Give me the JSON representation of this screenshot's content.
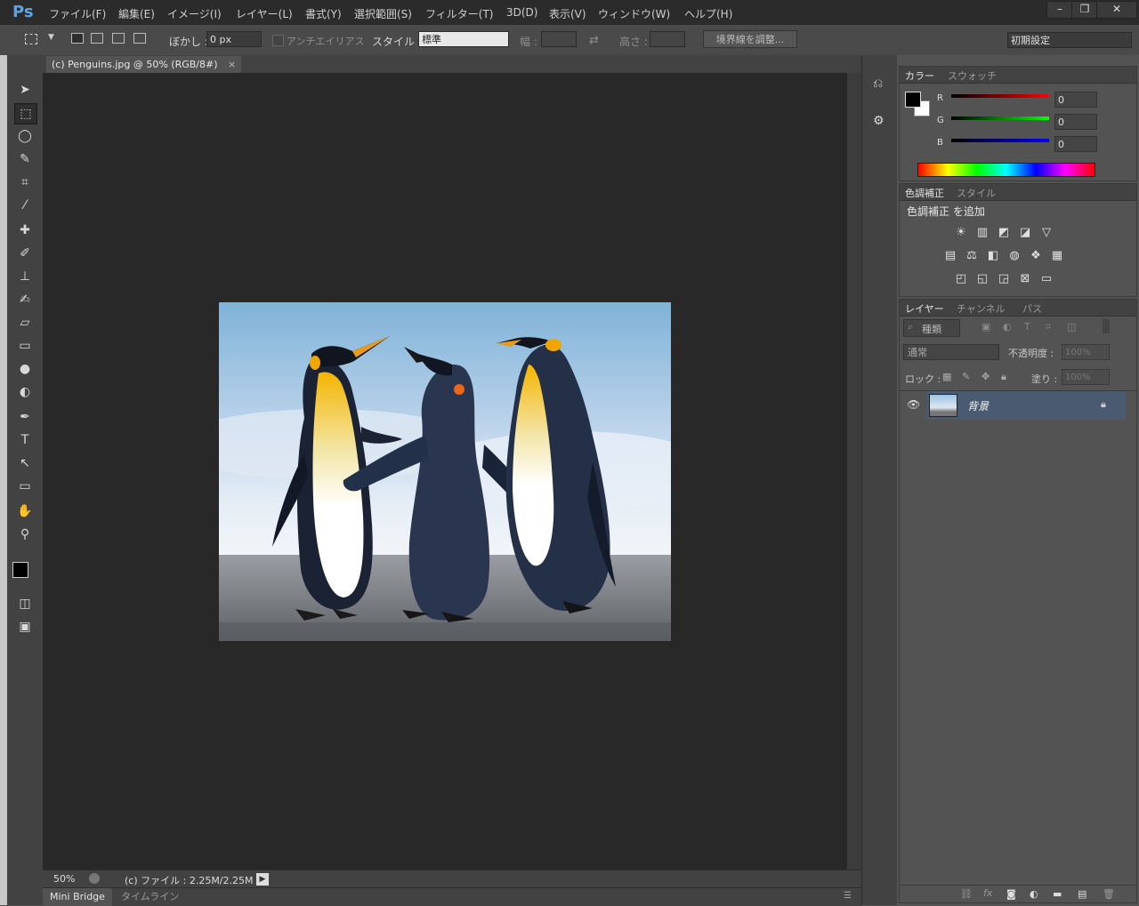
{
  "app": {
    "logo": "Ps"
  },
  "menu": [
    "ファイル(F)",
    "編集(E)",
    "イメージ(I)",
    "レイヤー(L)",
    "書式(Y)",
    "選択範囲(S)",
    "フィルター(T)",
    "3D(D)",
    "表示(V)",
    "ウィンドウ(W)",
    "ヘルプ(H)"
  ],
  "window_controls": {
    "minimize": "–",
    "restore": "❐",
    "close": "✕"
  },
  "options": {
    "feather_label": "ぼかし :",
    "feather_value": "0 px",
    "antialias_label": "アンチエイリアス",
    "style_label": "スタイル :",
    "style_value": "標準",
    "width_label": "幅 :",
    "height_label": "高さ :",
    "refine_button": "境界線を調整...",
    "workspace": "初期設定"
  },
  "document": {
    "tab_title": "(c) Penguins.jpg @ 50% (RGB/8#)",
    "close_glyph": "×",
    "zoom": "50%",
    "file_info": "(c) ファイル : 2.25M/2.25M"
  },
  "bottom_tabs": [
    "Mini Bridge",
    "タイムライン"
  ],
  "color_panel": {
    "tabs": [
      "カラー",
      "スウォッチ"
    ],
    "channels": [
      {
        "label": "R",
        "value": "0"
      },
      {
        "label": "G",
        "value": "0"
      },
      {
        "label": "B",
        "value": "0"
      }
    ]
  },
  "adjustments_panel": {
    "tabs": [
      "色調補正",
      "スタイル"
    ],
    "heading": "色調補正 を追加"
  },
  "layers_panel": {
    "tabs": [
      "レイヤー",
      "チャンネル",
      "パス"
    ],
    "filter_label": "種類",
    "blend_mode": "通常",
    "opacity_label": "不透明度 :",
    "opacity_value": "100%",
    "lock_label": "ロック :",
    "fill_label": "塗り :",
    "fill_value": "100%",
    "layers": [
      {
        "name": "背景"
      }
    ],
    "footer_fx": "fx"
  },
  "colors": {
    "accent": "#5fa3e0",
    "selected_layer": "#4a5a70",
    "canvas_bg": "#282828"
  }
}
